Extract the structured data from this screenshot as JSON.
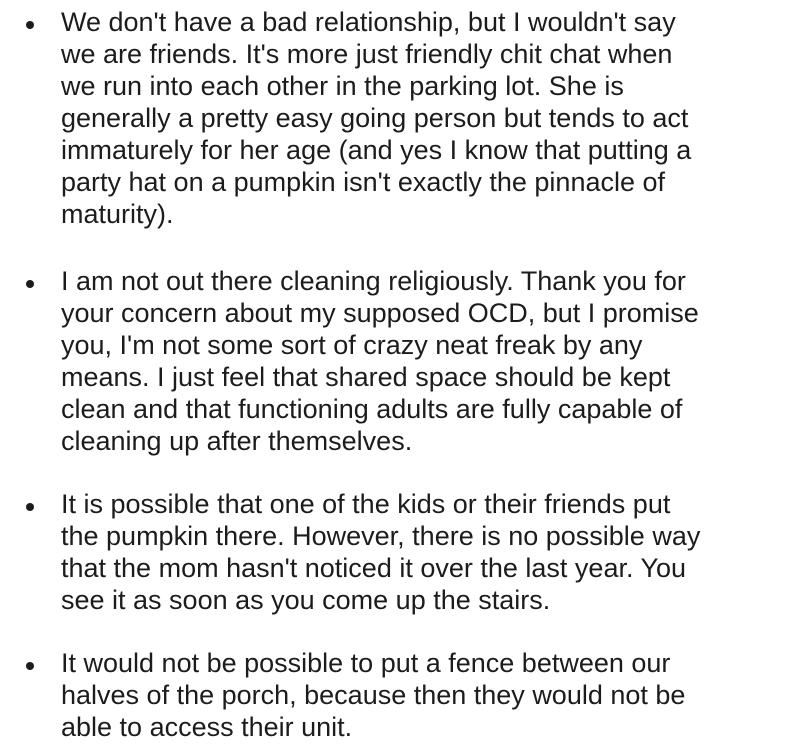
{
  "bullets": [
    {
      "lines": [
        "We don't have a bad relationship, but I wouldn't say",
        "we are friends. It's more just friendly chit chat when",
        "we run into each other in the parking lot. She is",
        "generally a pretty easy going person but tends to act",
        "immaturely for her age (and yes I know that putting a",
        "party hat on a pumpkin isn't exactly the pinnacle of",
        "maturity)."
      ]
    },
    {
      "lines": [
        "I am not out there cleaning religiously. Thank you for",
        "your concern about my supposed OCD, but I promise",
        "you, I'm not some sort of crazy neat freak by any",
        "means. I just feel that shared space should be kept",
        "clean and that functioning adults are fully capable of",
        "cleaning up after themselves."
      ]
    },
    {
      "lines": [
        "It is possible that one of the kids or their friends put",
        "the pumpkin there. However, there is no possible way",
        "that the mom hasn't noticed it over the last year. You",
        "see it as soon as you come up the stairs."
      ]
    },
    {
      "lines": [
        "It would not be possible to put a fence between our",
        "halves of the porch, because then they would not be",
        "able to access their unit."
      ]
    }
  ]
}
